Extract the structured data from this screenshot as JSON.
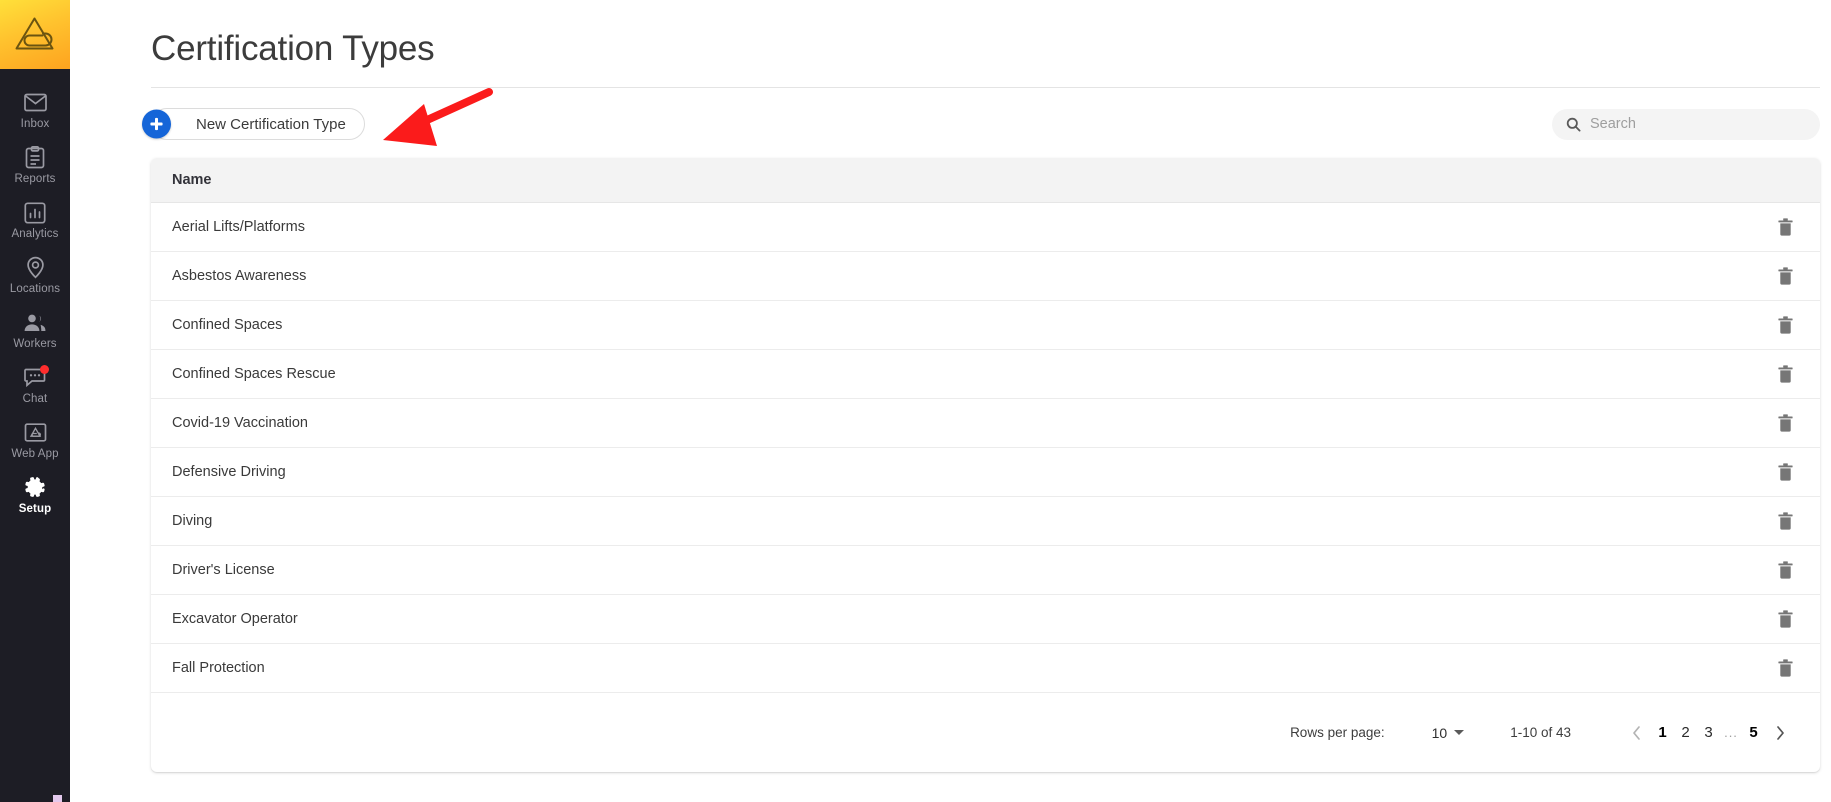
{
  "sidebar": {
    "logo": "logo-triangle-clip",
    "items": [
      {
        "label": "Inbox",
        "icon": "mail-icon",
        "active": false,
        "badge": false
      },
      {
        "label": "Reports",
        "icon": "clipboard-icon",
        "active": false,
        "badge": false
      },
      {
        "label": "Analytics",
        "icon": "bar-chart-icon",
        "active": false,
        "badge": false
      },
      {
        "label": "Locations",
        "icon": "map-pin-icon",
        "active": false,
        "badge": false
      },
      {
        "label": "Workers",
        "icon": "people-icon",
        "active": false,
        "badge": false
      },
      {
        "label": "Chat",
        "icon": "chat-icon",
        "active": false,
        "badge": true
      },
      {
        "label": "Web App",
        "icon": "web-app-icon",
        "active": false,
        "badge": false
      },
      {
        "label": "Setup",
        "icon": "gear-icon",
        "active": true,
        "badge": false
      }
    ]
  },
  "header": {
    "title": "Certification Types"
  },
  "toolbar": {
    "new_button_label": "New Certification Type",
    "new_button_icon": "plus-icon",
    "search_placeholder": "Search",
    "search_value": "",
    "search_icon": "search-icon"
  },
  "table": {
    "columns": [
      "Name"
    ],
    "row_action_icon": "trash-icon",
    "rows": [
      {
        "name": "Aerial Lifts/Platforms"
      },
      {
        "name": "Asbestos Awareness"
      },
      {
        "name": "Confined Spaces"
      },
      {
        "name": "Confined Spaces Rescue"
      },
      {
        "name": "Covid-19 Vaccination"
      },
      {
        "name": "Defensive Driving"
      },
      {
        "name": "Diving"
      },
      {
        "name": "Driver's License"
      },
      {
        "name": "Excavator Operator"
      },
      {
        "name": "Fall Protection"
      }
    ]
  },
  "pagination": {
    "rows_per_page_label": "Rows per page:",
    "rows_per_page_value": "10",
    "range_label": "1-10 of 43",
    "prev_icon": "chevron-left-icon",
    "next_icon": "chevron-right-icon",
    "pages": [
      "1",
      "2",
      "3"
    ],
    "ellipsis": "...",
    "last_page": "5",
    "current_page": "1"
  },
  "annotation": {
    "type": "arrow",
    "color": "#fb1b1b",
    "points_at": "New Certification Type"
  },
  "colors": {
    "sidebar_bg": "#1d1d25",
    "accent_blue": "#1565d8",
    "logo_gradient_start": "#ffe03a",
    "logo_gradient_end": "#fda31f",
    "annotation_red": "#fb1b1b",
    "table_header_bg": "#f3f3f3",
    "badge_red": "#ff2d2d"
  }
}
